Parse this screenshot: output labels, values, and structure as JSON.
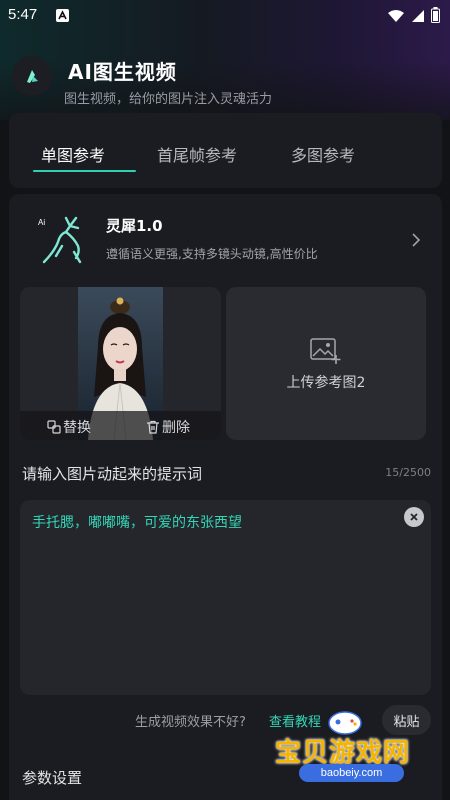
{
  "status_bar": {
    "time": "5:47",
    "icons": [
      "a-badge-icon",
      "wifi-icon",
      "signal-icon",
      "battery-icon"
    ]
  },
  "header": {
    "title": "AI图生视频",
    "subtitle": "图生视频，给你的图片注入灵魂活力"
  },
  "tabs": [
    {
      "label": "单图参考",
      "active": true
    },
    {
      "label": "首尾帧参考",
      "active": false
    },
    {
      "label": "多图参考",
      "active": false
    }
  ],
  "model": {
    "logo_tag": "Ai",
    "name": "灵犀1.0",
    "description": "遵循语义更强,支持多镜头动镜,高性价比"
  },
  "reference_image": {
    "replace_label": "替换",
    "delete_label": "删除"
  },
  "upload": {
    "label": "上传参考图2"
  },
  "prompt": {
    "heading": "请输入图片动起来的提示词",
    "count": "15/2500",
    "text": "手托腮，嘟嘟嘴，可爱的东张西望"
  },
  "help": {
    "text": "生成视频效果不好?",
    "link": "查看教程",
    "paste_label": "粘贴"
  },
  "params": {
    "heading": "参数设置"
  },
  "watermark": {
    "brand": "宝贝游戏网",
    "url": "baobeiy.com"
  },
  "colors": {
    "accent": "#33d6b5",
    "card": "#1b1c21",
    "background": "#121316"
  }
}
